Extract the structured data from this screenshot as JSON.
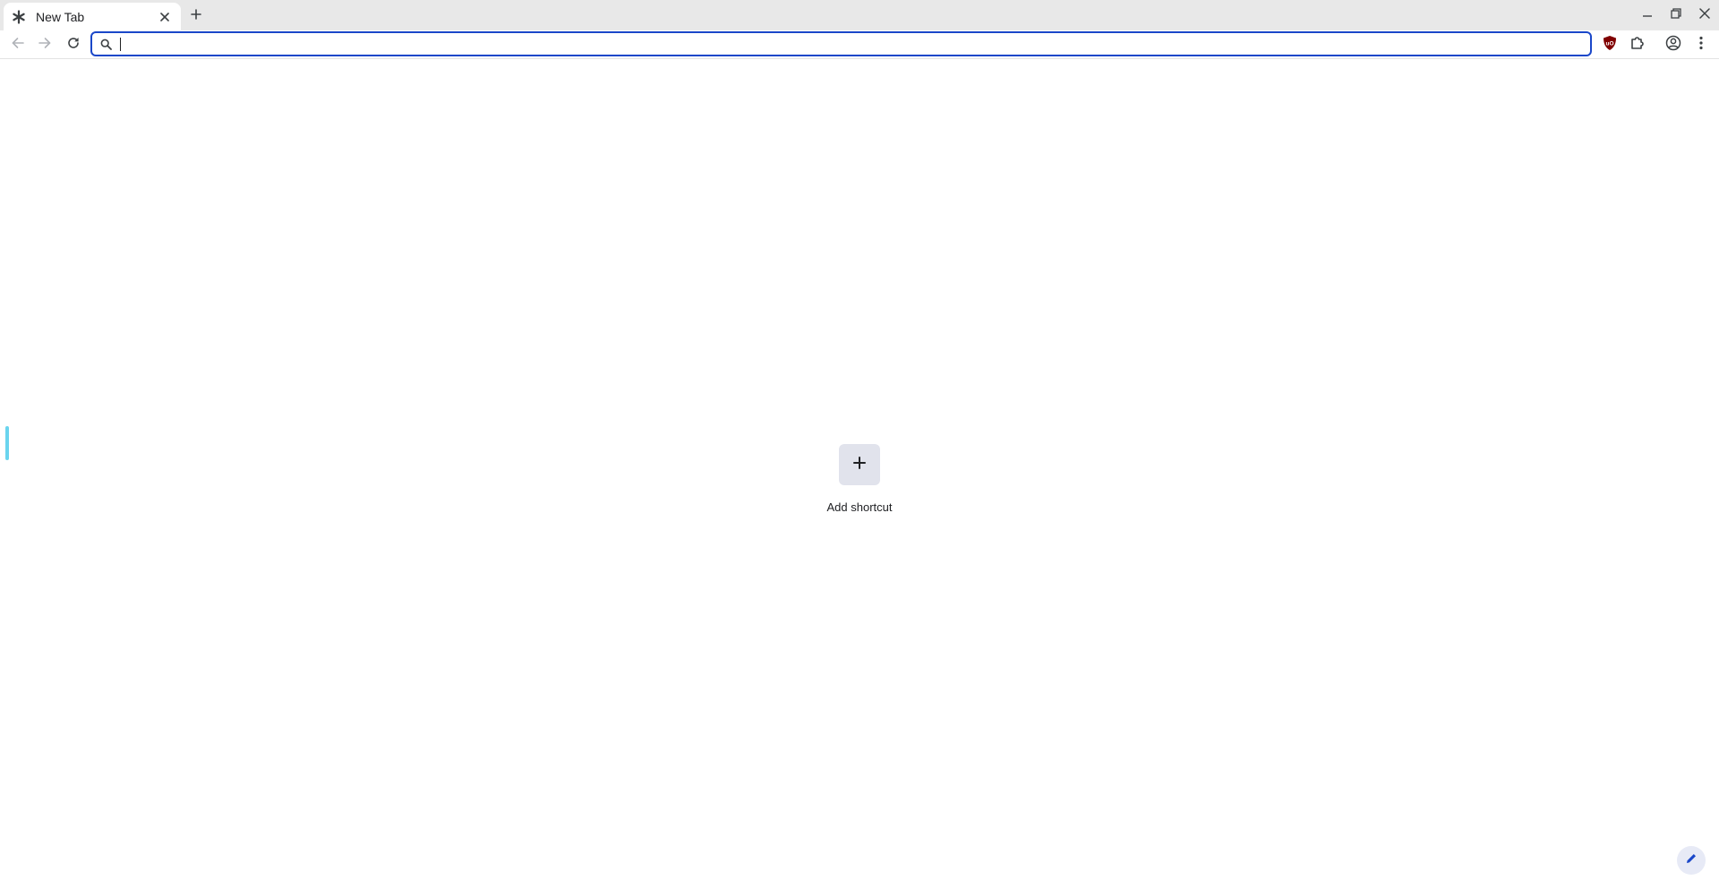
{
  "tab": {
    "title": "New Tab",
    "favicon": "chrome-asterisk-icon",
    "close_icon": "close-icon"
  },
  "tabstrip": {
    "new_tab_icon": "plus-icon"
  },
  "window_controls": [
    "minimize-icon",
    "restore-icon",
    "close-icon"
  ],
  "toolbar": {
    "back_icon": "arrow-left-icon",
    "forward_icon": "arrow-right-icon",
    "reload_icon": "reload-icon",
    "extensions": [
      "ublock-origin-icon",
      "puzzle-piece-icon"
    ],
    "profile_icon": "account-circle-icon",
    "menu_icon": "kebab-menu-icon"
  },
  "omnibox": {
    "value": "",
    "placeholder": "",
    "search_icon": "search-icon"
  },
  "shortcuts": [
    {
      "label": "Add shortcut",
      "icon": "plus-icon"
    }
  ],
  "customize": {
    "icon": "pencil-icon"
  },
  "colors": {
    "accent": "#1a47c9",
    "tabstrip_bg": "#e8e8e8",
    "shortcut_tile_bg": "#e1e3ec",
    "side_indicator": "#6ad4ee",
    "ublock_red": "#800000"
  }
}
